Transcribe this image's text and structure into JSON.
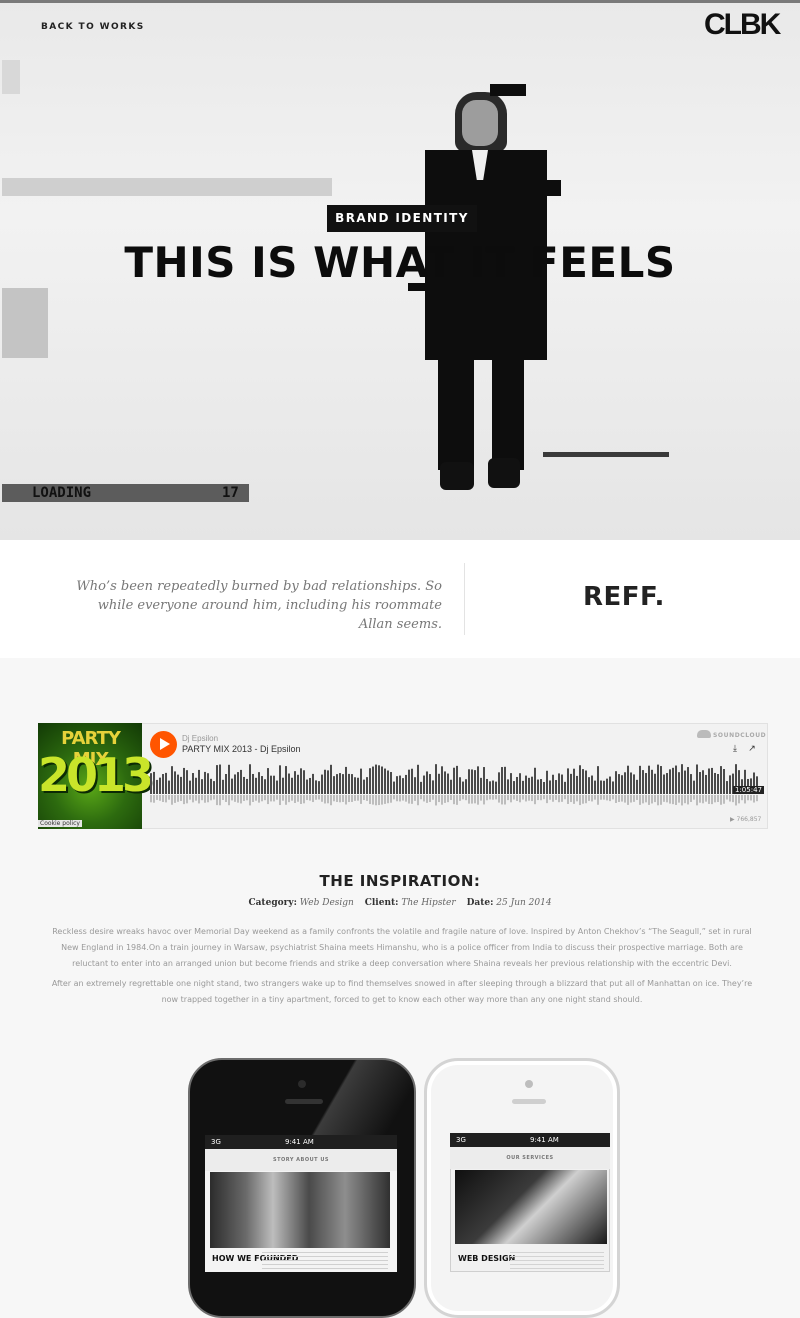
{
  "nav": {
    "back_label": "BACK TO WORKS",
    "logo": "CLBK"
  },
  "hero": {
    "badge": "BRAND IDENTITY",
    "title": "THIS IS WHAT IT FEELS",
    "loading_label": "LOADING",
    "loading_count": "17"
  },
  "quote": {
    "text": "Who’s been repeatedly burned by bad relationships. So while everyone around him, including his roommate Allan seems.",
    "brand": "REFF."
  },
  "player": {
    "artwork_top": "PARTY MIX",
    "artwork_year": "2013",
    "cookie": "Cookie policy",
    "artist": "Dj Epsilon",
    "track": "PARTY MIX 2013 - Dj Epsilon",
    "provider": "SOUNDCLOUD",
    "duration": "1:05:47",
    "plays": "▶ 766,857",
    "accent": "#ff5500"
  },
  "inspiration": {
    "title": "THE INSPIRATION:",
    "category_label": "Category:",
    "category_value": "Web Design",
    "client_label": "Client:",
    "client_value": "The Hipster",
    "date_label": "Date:",
    "date_value": "25 Jun 2014",
    "p1": "Reckless desire wreaks havoc over Memorial Day weekend as a family confronts the volatile and fragile nature of love. Inspired by Anton Chekhov’s “The Seagull,” set in rural New England in 1984.On a train journey in Warsaw, psychiatrist Shaina meets Himanshu, who is a police officer from India to discuss their prospective marriage. Both are reluctant to enter into an arranged union but become friends and strike a deep conversation where Shaina reveals her previous relationship with the eccentric Devi.",
    "p2": "After an extremely regrettable one night stand, two strangers wake up to find themselves snowed in after sleeping through a blizzard that put all of Manhattan on ice. They’re now trapped together in a tiny apartment, forced to get to know each other way more than any one night stand should."
  },
  "phones": {
    "left": {
      "carrier": "3G",
      "time": "9:41 AM",
      "header": "STORY ABOUT US",
      "heading": "HOW WE FOUNDED"
    },
    "right": {
      "carrier": "3G",
      "time": "9:41 AM",
      "header": "OUR SERVICES",
      "heading": "WEB DESIGN"
    }
  }
}
